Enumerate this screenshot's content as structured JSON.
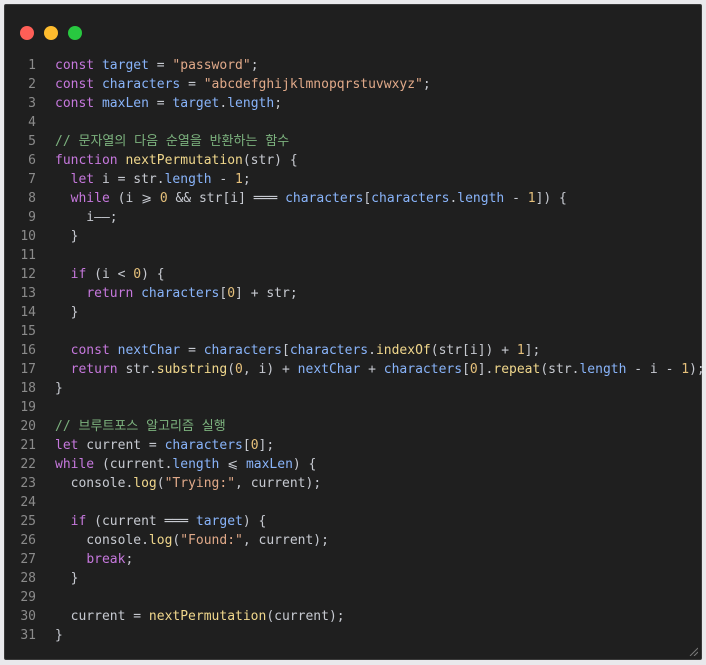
{
  "window": {
    "controls": [
      "close",
      "minimize",
      "maximize"
    ],
    "colors": {
      "close": "#ff5f57",
      "minimize": "#febc2e",
      "maximize": "#28c840",
      "background": "#1f1f1f"
    }
  },
  "code": {
    "language": "javascript",
    "lines": [
      {
        "n": "1",
        "tokens": [
          [
            "keyword",
            "const"
          ],
          [
            "plain",
            " "
          ],
          [
            "var",
            "target"
          ],
          [
            "plain",
            " = "
          ],
          [
            "string",
            "\"password\""
          ],
          [
            "plain",
            ";"
          ]
        ]
      },
      {
        "n": "2",
        "tokens": [
          [
            "keyword",
            "const"
          ],
          [
            "plain",
            " "
          ],
          [
            "var",
            "characters"
          ],
          [
            "plain",
            " = "
          ],
          [
            "string",
            "\"abcdefghijklmnopqrstuvwxyz\""
          ],
          [
            "plain",
            ";"
          ]
        ]
      },
      {
        "n": "3",
        "tokens": [
          [
            "keyword",
            "const"
          ],
          [
            "plain",
            " "
          ],
          [
            "var",
            "maxLen"
          ],
          [
            "plain",
            " = "
          ],
          [
            "var",
            "target"
          ],
          [
            "plain",
            "."
          ],
          [
            "var",
            "length"
          ],
          [
            "plain",
            ";"
          ]
        ]
      },
      {
        "n": "4",
        "tokens": []
      },
      {
        "n": "5",
        "tokens": [
          [
            "comment",
            "// 문자열의 다음 순열을 반환하는 함수"
          ]
        ]
      },
      {
        "n": "6",
        "tokens": [
          [
            "keyword",
            "function"
          ],
          [
            "plain",
            " "
          ],
          [
            "func",
            "nextPermutation"
          ],
          [
            "plain",
            "(str) {"
          ]
        ]
      },
      {
        "n": "7",
        "tokens": [
          [
            "plain",
            "  "
          ],
          [
            "keyword",
            "let"
          ],
          [
            "plain",
            " i = str."
          ],
          [
            "var",
            "length"
          ],
          [
            "plain",
            " - "
          ],
          [
            "number",
            "1"
          ],
          [
            "plain",
            ";"
          ]
        ]
      },
      {
        "n": "8",
        "tokens": [
          [
            "plain",
            "  "
          ],
          [
            "keyword",
            "while"
          ],
          [
            "plain",
            " (i ⩾ "
          ],
          [
            "number",
            "0"
          ],
          [
            "plain",
            " && str[i] ═══ "
          ],
          [
            "var",
            "characters"
          ],
          [
            "plain",
            "["
          ],
          [
            "var",
            "characters"
          ],
          [
            "plain",
            "."
          ],
          [
            "var",
            "length"
          ],
          [
            "plain",
            " - "
          ],
          [
            "number",
            "1"
          ],
          [
            "plain",
            "]) {"
          ]
        ]
      },
      {
        "n": "9",
        "tokens": [
          [
            "plain",
            "    i——;"
          ]
        ]
      },
      {
        "n": "10",
        "tokens": [
          [
            "plain",
            "  }"
          ]
        ]
      },
      {
        "n": "11",
        "tokens": []
      },
      {
        "n": "12",
        "tokens": [
          [
            "plain",
            "  "
          ],
          [
            "keyword",
            "if"
          ],
          [
            "plain",
            " (i < "
          ],
          [
            "number",
            "0"
          ],
          [
            "plain",
            ") {"
          ]
        ]
      },
      {
        "n": "13",
        "tokens": [
          [
            "plain",
            "    "
          ],
          [
            "keyword",
            "return"
          ],
          [
            "plain",
            " "
          ],
          [
            "var",
            "characters"
          ],
          [
            "plain",
            "["
          ],
          [
            "number",
            "0"
          ],
          [
            "plain",
            "] + str;"
          ]
        ]
      },
      {
        "n": "14",
        "tokens": [
          [
            "plain",
            "  }"
          ]
        ]
      },
      {
        "n": "15",
        "tokens": []
      },
      {
        "n": "16",
        "tokens": [
          [
            "plain",
            "  "
          ],
          [
            "keyword",
            "const"
          ],
          [
            "plain",
            " "
          ],
          [
            "var",
            "nextChar"
          ],
          [
            "plain",
            " = "
          ],
          [
            "var",
            "characters"
          ],
          [
            "plain",
            "["
          ],
          [
            "var",
            "characters"
          ],
          [
            "plain",
            "."
          ],
          [
            "func",
            "indexOf"
          ],
          [
            "plain",
            "(str[i]) + "
          ],
          [
            "number",
            "1"
          ],
          [
            "plain",
            "];"
          ]
        ]
      },
      {
        "n": "17",
        "tokens": [
          [
            "plain",
            "  "
          ],
          [
            "keyword",
            "return"
          ],
          [
            "plain",
            " str."
          ],
          [
            "func",
            "substring"
          ],
          [
            "plain",
            "("
          ],
          [
            "number",
            "0"
          ],
          [
            "plain",
            ", i) + "
          ],
          [
            "var",
            "nextChar"
          ],
          [
            "plain",
            " + "
          ],
          [
            "var",
            "characters"
          ],
          [
            "plain",
            "["
          ],
          [
            "number",
            "0"
          ],
          [
            "plain",
            "]."
          ],
          [
            "func",
            "repeat"
          ],
          [
            "plain",
            "(str."
          ],
          [
            "var",
            "length"
          ],
          [
            "plain",
            " - i - "
          ],
          [
            "number",
            "1"
          ],
          [
            "plain",
            ");"
          ]
        ]
      },
      {
        "n": "18",
        "tokens": [
          [
            "plain",
            "}"
          ]
        ]
      },
      {
        "n": "19",
        "tokens": []
      },
      {
        "n": "20",
        "tokens": [
          [
            "comment",
            "// 브루트포스 알고리즘 실행"
          ]
        ]
      },
      {
        "n": "21",
        "tokens": [
          [
            "keyword",
            "let"
          ],
          [
            "plain",
            " current = "
          ],
          [
            "var",
            "characters"
          ],
          [
            "plain",
            "["
          ],
          [
            "number",
            "0"
          ],
          [
            "plain",
            "];"
          ]
        ]
      },
      {
        "n": "22",
        "tokens": [
          [
            "keyword",
            "while"
          ],
          [
            "plain",
            " (current."
          ],
          [
            "var",
            "length"
          ],
          [
            "plain",
            " ⩽ "
          ],
          [
            "var",
            "maxLen"
          ],
          [
            "plain",
            ") {"
          ]
        ]
      },
      {
        "n": "23",
        "tokens": [
          [
            "plain",
            "  console."
          ],
          [
            "func",
            "log"
          ],
          [
            "plain",
            "("
          ],
          [
            "string",
            "\"Trying:\""
          ],
          [
            "plain",
            ", current);"
          ]
        ]
      },
      {
        "n": "24",
        "tokens": []
      },
      {
        "n": "25",
        "tokens": [
          [
            "plain",
            "  "
          ],
          [
            "keyword",
            "if"
          ],
          [
            "plain",
            " (current ═══ "
          ],
          [
            "var",
            "target"
          ],
          [
            "plain",
            ") {"
          ]
        ]
      },
      {
        "n": "26",
        "tokens": [
          [
            "plain",
            "    console."
          ],
          [
            "func",
            "log"
          ],
          [
            "plain",
            "("
          ],
          [
            "string",
            "\"Found:\""
          ],
          [
            "plain",
            ", current);"
          ]
        ]
      },
      {
        "n": "27",
        "tokens": [
          [
            "plain",
            "    "
          ],
          [
            "keyword",
            "break"
          ],
          [
            "plain",
            ";"
          ]
        ]
      },
      {
        "n": "28",
        "tokens": [
          [
            "plain",
            "  }"
          ]
        ]
      },
      {
        "n": "29",
        "tokens": []
      },
      {
        "n": "30",
        "tokens": [
          [
            "plain",
            "  current = "
          ],
          [
            "func",
            "nextPermutation"
          ],
          [
            "plain",
            "(current);"
          ]
        ]
      },
      {
        "n": "31",
        "tokens": [
          [
            "plain",
            "}"
          ]
        ]
      }
    ]
  }
}
